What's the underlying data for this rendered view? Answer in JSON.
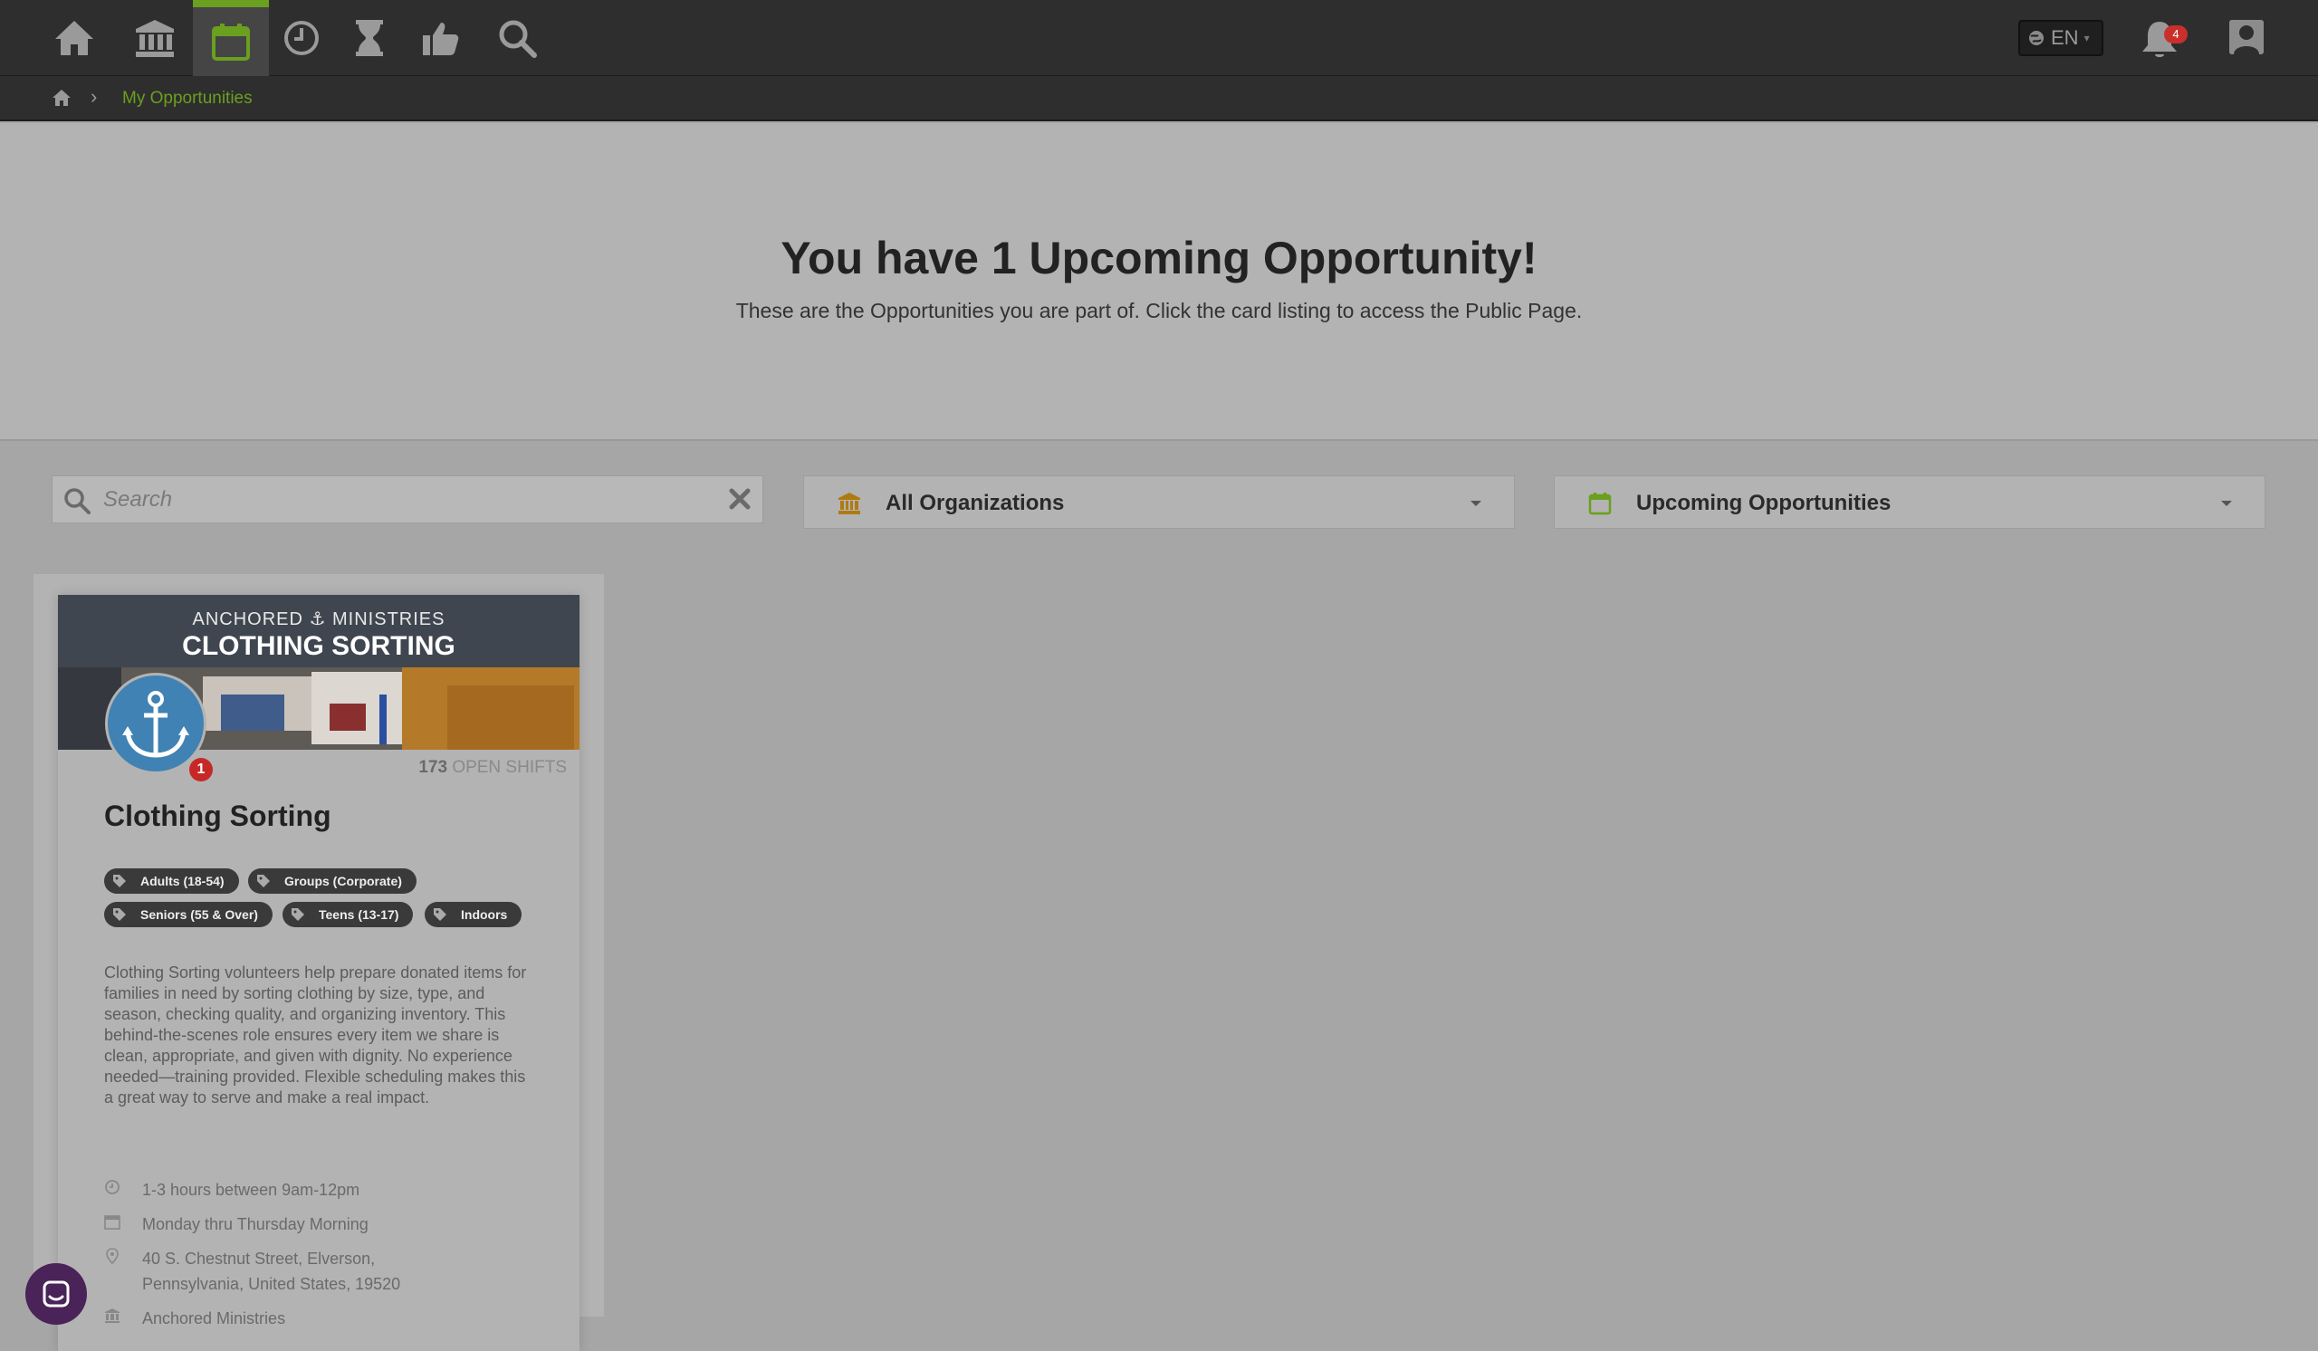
{
  "nav": {
    "items": [
      "home-icon",
      "institution-icon",
      "calendar-icon",
      "clock-icon",
      "hourglass-icon",
      "thumbs-up-icon",
      "search-icon"
    ],
    "active_index": 2,
    "language": "EN",
    "notification_count": "4",
    "accent_color": "#6a9f1f"
  },
  "breadcrumb": {
    "separator": "›",
    "current": "My Opportunities"
  },
  "hero": {
    "title": "You have 1 Upcoming Opportunity!",
    "subtitle": "These are the Opportunities you are part of. Click the card listing to access the Public Page."
  },
  "filters": {
    "search_placeholder": "Search",
    "organization": "All Organizations",
    "timeframe": "Upcoming Opportunities"
  },
  "card": {
    "banner_org": "ANCHORED ⚓ MINISTRIES",
    "banner_title": "CLOTHING SORTING",
    "logo_badge": "1",
    "open_shifts_count": "173",
    "open_shifts_label": "OPEN SHIFTS",
    "title": "Clothing Sorting",
    "tags": [
      "Adults (18-54)",
      "Groups (Corporate)",
      "Seniors (55 & Over)",
      "Teens (13-17)",
      "Indoors"
    ],
    "description": "Clothing Sorting volunteers help prepare donated items for families in need by sorting clothing by size, type, and season, checking quality, and organizing inventory. This behind-the-scenes role ensures every item we share is clean, appropriate, and given with dignity. No experience needed—training provided. Flexible scheduling makes this a great way to serve and make a real impact.",
    "duration": "1-3 hours between 9am-12pm",
    "schedule": "Monday thru Thursday Morning",
    "address_line1": "40 S. Chestnut Street, Elverson,",
    "address_line2": "Pennsylvania, United States, 19520",
    "organization": "Anchored Ministries"
  }
}
